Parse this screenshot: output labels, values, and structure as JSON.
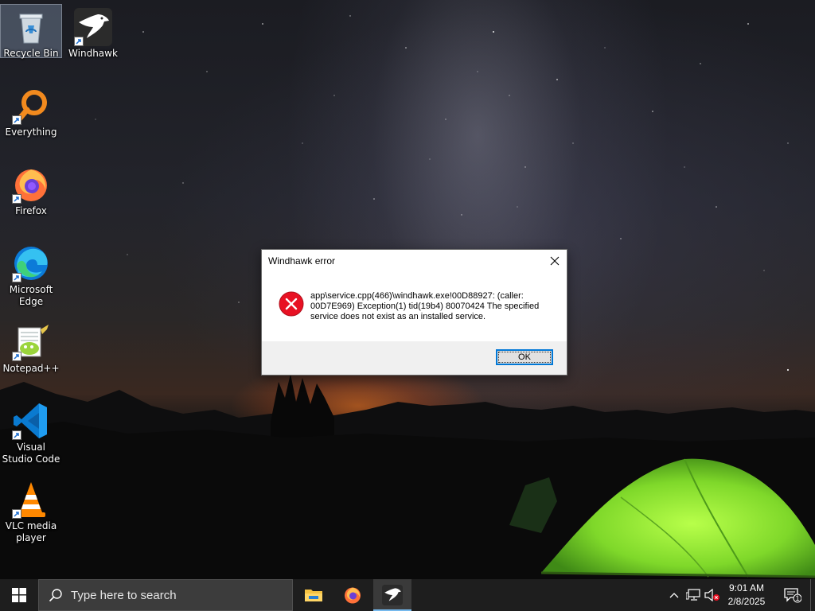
{
  "desktop": {
    "icons": [
      {
        "label": "Recycle Bin",
        "icon": "recycle-bin-icon"
      },
      {
        "label": "Windhawk",
        "icon": "windhawk-icon"
      },
      {
        "label": "Everything",
        "icon": "everything-search-icon"
      },
      {
        "label": "Firefox",
        "icon": "firefox-icon"
      },
      {
        "label": "Microsoft Edge",
        "icon": "edge-icon"
      },
      {
        "label": "Notepad++",
        "icon": "notepadpp-icon"
      },
      {
        "label": "Visual Studio Code",
        "icon": "vscode-icon"
      },
      {
        "label": "VLC media player",
        "icon": "vlc-icon"
      }
    ]
  },
  "dialog": {
    "title": "Windhawk error",
    "message": "app\\service.cpp(466)\\windhawk.exe!00D88927: (caller: 00D7E969) Exception(1) tid(19b4) 80070424 The specified service does not exist as an installed service.",
    "ok_label": "OK",
    "icon": "error-icon"
  },
  "taskbar": {
    "search_placeholder": "Type here to search",
    "pinned": [
      "file-explorer-icon",
      "firefox-icon",
      "windhawk-icon"
    ],
    "active_app": "windhawk-icon",
    "tray": {
      "time": "9:01 AM",
      "date": "2/8/2025",
      "notification_count": "1",
      "icons": [
        "chevron-up-icon",
        "network-icon",
        "volume-muted-icon"
      ]
    }
  },
  "colors": {
    "accent": "#0078d7",
    "error_red": "#e81123",
    "taskbar": "#1e1e1e"
  }
}
